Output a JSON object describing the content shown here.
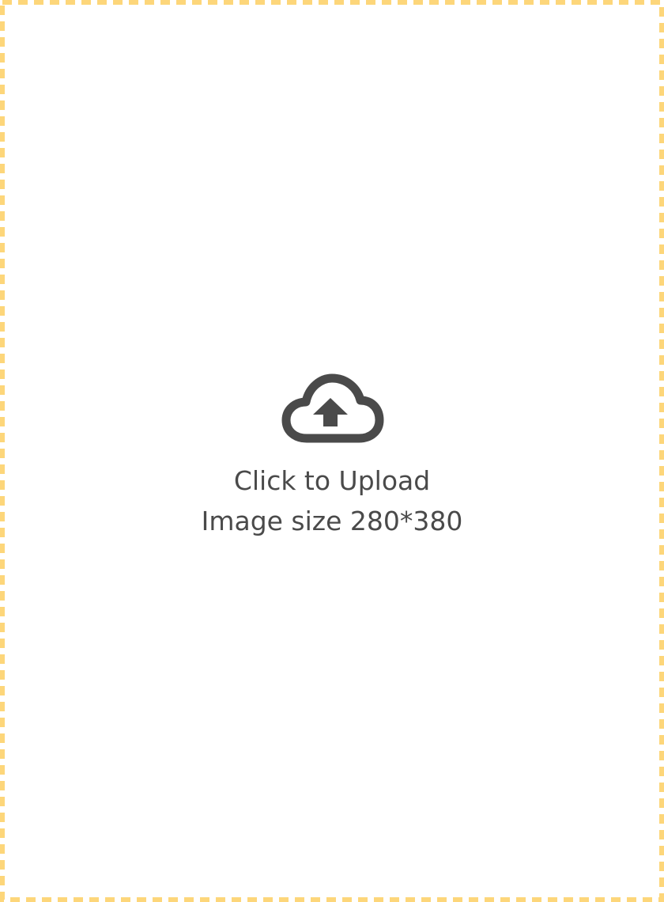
{
  "upload": {
    "title": "Click to Upload",
    "hint": "Image size 280*380",
    "icon": "cloud-upload-icon",
    "border_color": "#fdd67a",
    "text_color": "#4a4a4a"
  }
}
